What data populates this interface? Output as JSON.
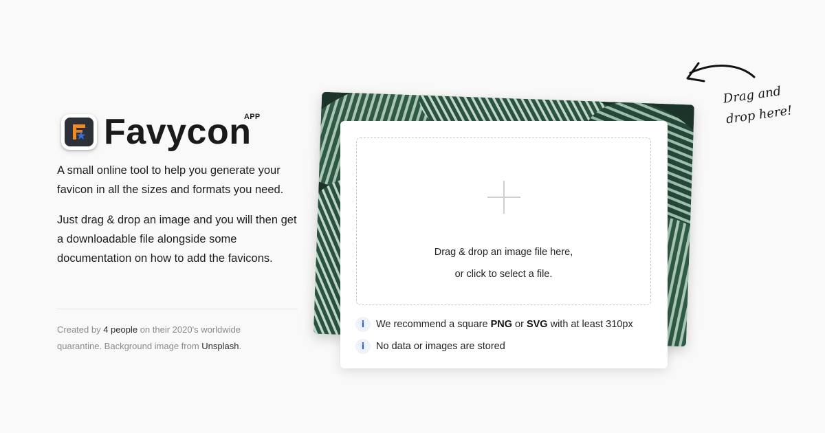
{
  "brand": {
    "name": "Favycon",
    "tag": "APP",
    "logo_icon": "favycon-logo-icon"
  },
  "description": {
    "p1": "A small online tool to help you generate your favicon in all the sizes and formats you need.",
    "p2": "Just drag & drop an image and you will then get a downloadable file alongside some documentation on how to add the favicons."
  },
  "credits": {
    "prefix": "Created by ",
    "people_link": "4 people",
    "middle": " on their 2020's worldwide quarantine. Background image from ",
    "unsplash_link": "Unsplash",
    "suffix": "."
  },
  "dropzone": {
    "plus_icon": "plus-icon",
    "line1": "Drag & drop an image file here,",
    "line2": "or click to select a file."
  },
  "info": [
    {
      "icon": "info-icon",
      "parts": [
        "We recommend a square ",
        "PNG",
        " or ",
        "SVG",
        " with at least 310px"
      ]
    },
    {
      "icon": "info-icon",
      "text": "No data or images are stored"
    }
  ],
  "hint": {
    "line1": "Drag and",
    "line2": "drop here!",
    "arrow_icon": "hand-drawn-arrow-icon"
  },
  "colors": {
    "background": "#f9f9f9",
    "info_accent": "#2f5fd0",
    "logo_orange": "#f08a24",
    "logo_blue": "#3b6fe0"
  }
}
